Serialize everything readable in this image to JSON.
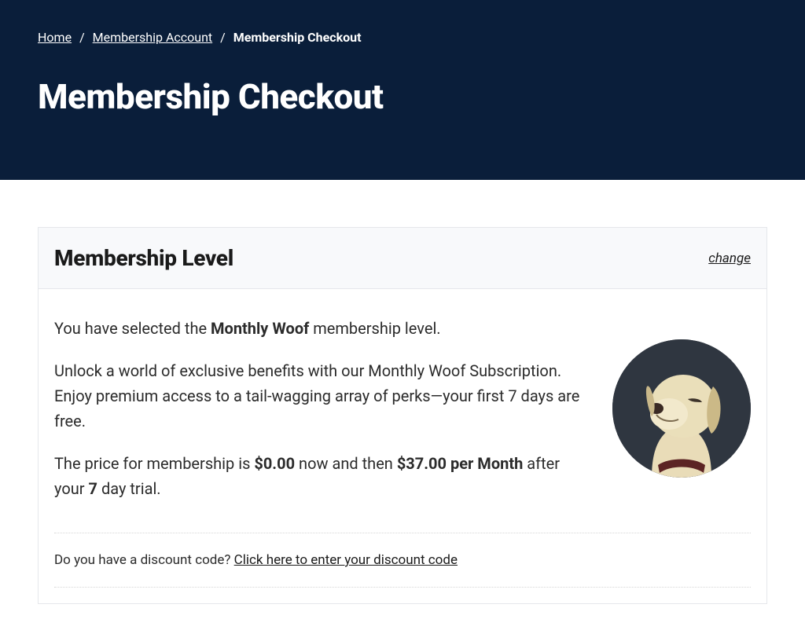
{
  "breadcrumb": {
    "home": "Home",
    "account": "Membership Account",
    "current": "Membership Checkout"
  },
  "page_title": "Membership Checkout",
  "level_section": {
    "heading": "Membership Level",
    "change_label": "change"
  },
  "selection": {
    "prefix": "You have selected the ",
    "level_name": "Monthly Woof",
    "suffix": " membership level."
  },
  "description": "Unlock a world of exclusive benefits with our Monthly Woof Subscription. Enjoy premium access to a tail-wagging array of perks—your first 7 days are free.",
  "pricing": {
    "p1": "The price for membership is ",
    "initial": "$0.00",
    "p2": " now and then ",
    "recurring": "$37.00 per Month",
    "p3": " after your ",
    "trial_days": "7",
    "p4": " day trial."
  },
  "discount": {
    "prompt": "Do you have a discount code? ",
    "link": "Click here to enter your discount code"
  }
}
